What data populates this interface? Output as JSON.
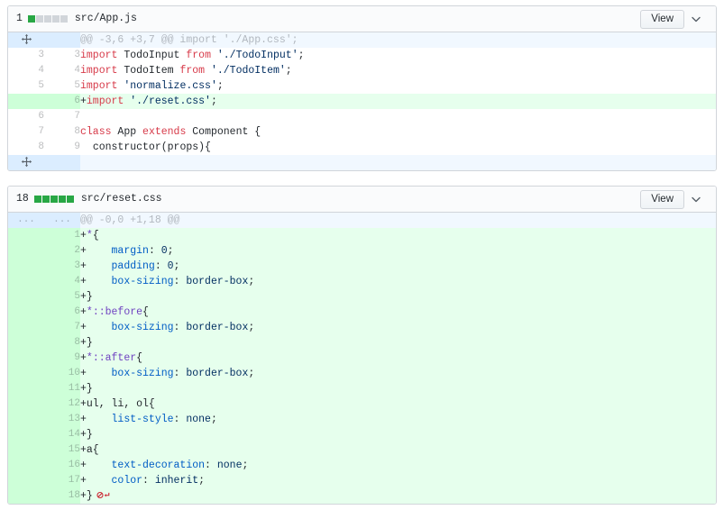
{
  "files": [
    {
      "change_count": "1",
      "diffstat": [
        "green",
        "gray",
        "gray",
        "gray",
        "gray"
      ],
      "path": "src/App.js",
      "view_label": "View",
      "caret_icon": "chevron-down-icon",
      "expander_top_icon": "unfold-icon",
      "expander_bottom_icon": "unfold-icon",
      "hunk_header": "@@ -3,6 +3,7 @@ import './App.css';",
      "rows": [
        {
          "type": "hunk",
          "old": "",
          "new": "",
          "text": "@@ -3,6 +3,7 @@ import './App.css';"
        },
        {
          "type": "ctx",
          "old": "3",
          "new": "3",
          "text": "import TodoInput from './TodoInput';"
        },
        {
          "type": "ctx",
          "old": "4",
          "new": "4",
          "text": "import TodoItem from './TodoItem';"
        },
        {
          "type": "ctx",
          "old": "5",
          "new": "5",
          "text": "import 'normalize.css';"
        },
        {
          "type": "add",
          "old": "",
          "new": "6",
          "text": "+import './reset.css';"
        },
        {
          "type": "ctx",
          "old": "6",
          "new": "7",
          "text": ""
        },
        {
          "type": "ctx",
          "old": "7",
          "new": "8",
          "text": "class App extends Component {"
        },
        {
          "type": "ctx",
          "old": "8",
          "new": "9",
          "text": "  constructor(props){"
        },
        {
          "type": "expander",
          "old": "",
          "new": "",
          "text": ""
        }
      ]
    },
    {
      "change_count": "18",
      "diffstat": [
        "green",
        "green",
        "green",
        "green",
        "green"
      ],
      "path": "src/reset.css",
      "view_label": "View",
      "caret_icon": "chevron-down-icon",
      "hunk_header": "@@ -0,0 +1,18 @@",
      "hunk_gutter_old": "...",
      "hunk_gutter_new": "...",
      "add_comment_button": {
        "line": "3",
        "icon": "plus-icon"
      },
      "no_newline_marker": "no-newline-at-eof-icon",
      "rows": [
        {
          "type": "hunk",
          "old": "...",
          "new": "...",
          "text": "@@ -0,0 +1,18 @@"
        },
        {
          "type": "add",
          "old": "",
          "new": "1",
          "text": "+*{"
        },
        {
          "type": "add",
          "old": "",
          "new": "2",
          "text": "+    margin: 0;"
        },
        {
          "type": "add",
          "old": "",
          "new": "3",
          "text": "+    padding: 0;"
        },
        {
          "type": "add",
          "old": "",
          "new": "4",
          "text": "+    box-sizing: border-box;"
        },
        {
          "type": "add",
          "old": "",
          "new": "5",
          "text": "+}"
        },
        {
          "type": "add",
          "old": "",
          "new": "6",
          "text": "+*::before{"
        },
        {
          "type": "add",
          "old": "",
          "new": "7",
          "text": "+    box-sizing: border-box;"
        },
        {
          "type": "add",
          "old": "",
          "new": "8",
          "text": "+}"
        },
        {
          "type": "add",
          "old": "",
          "new": "9",
          "text": "+*::after{"
        },
        {
          "type": "add",
          "old": "",
          "new": "10",
          "text": "+    box-sizing: border-box;"
        },
        {
          "type": "add",
          "old": "",
          "new": "11",
          "text": "+}"
        },
        {
          "type": "add",
          "old": "",
          "new": "12",
          "text": "+ul, li, ol{"
        },
        {
          "type": "add",
          "old": "",
          "new": "13",
          "text": "+    list-style: none;"
        },
        {
          "type": "add",
          "old": "",
          "new": "14",
          "text": "+}"
        },
        {
          "type": "add",
          "old": "",
          "new": "15",
          "text": "+a{"
        },
        {
          "type": "add",
          "old": "",
          "new": "16",
          "text": "+    text-decoration: none;"
        },
        {
          "type": "add",
          "old": "",
          "new": "17",
          "text": "+    color: inherit;"
        },
        {
          "type": "add",
          "old": "",
          "new": "18",
          "text": "+}"
        }
      ]
    }
  ],
  "colors": {
    "added_bg": "#e6ffed",
    "added_gutter": "#cdffd8",
    "hunk_bg": "#f1f8ff",
    "hunk_gutter": "#dbedff",
    "border": "#d1d5da",
    "diffstat_green": "#28a745",
    "diffstat_gray": "#d1d5da",
    "accent_blue": "#0366d6",
    "keyword_red": "#d73a49",
    "string_blue": "#032f62",
    "selector_purple": "#6f42c1"
  }
}
